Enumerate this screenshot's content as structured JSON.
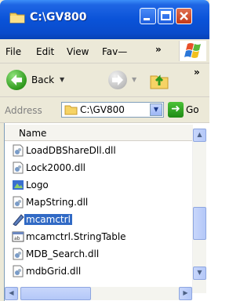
{
  "window": {
    "title": "C:\\GV800"
  },
  "menu": {
    "file": "File",
    "edit": "Edit",
    "view": "View",
    "favorites": "Fav—",
    "more": "»"
  },
  "toolbar": {
    "back_label": "Back",
    "more": "»"
  },
  "address": {
    "label": "Address",
    "value": "C:\\GV800",
    "go_label": "Go"
  },
  "list": {
    "column_header": "Name",
    "items": [
      {
        "name": "LoadDBShareDll.dll",
        "icon": "dll-icon"
      },
      {
        "name": "Lock2000.dll",
        "icon": "dll-icon"
      },
      {
        "name": "Logo",
        "icon": "shortcut-icon"
      },
      {
        "name": "MapString.dll",
        "icon": "dll-icon"
      },
      {
        "name": "mcamctrl",
        "icon": "control-icon",
        "selected": true
      },
      {
        "name": "mcamctrl.StringTable",
        "icon": "table-icon"
      },
      {
        "name": "MDB_Search.dll",
        "icon": "dll-icon"
      },
      {
        "name": "mdbGrid.dll",
        "icon": "dll-icon"
      }
    ]
  }
}
